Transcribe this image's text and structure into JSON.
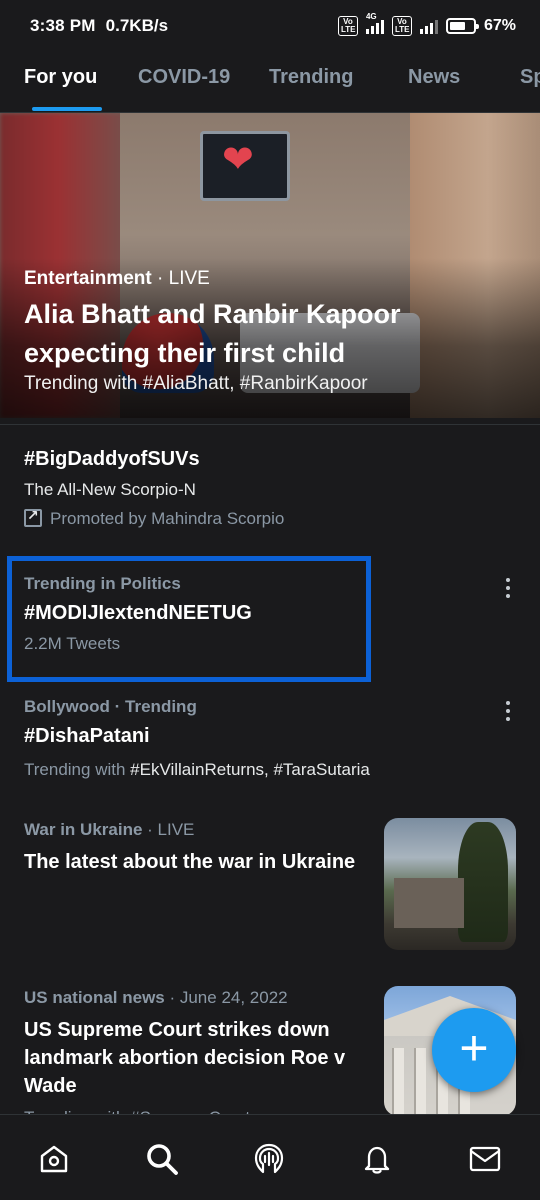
{
  "status_bar": {
    "time": "3:38 PM",
    "net_speed": "0.7KB/s",
    "volte_label": "Vo LTE",
    "network_label": "4G",
    "battery": "67%"
  },
  "tabs": [
    {
      "label": "For you",
      "active": true
    },
    {
      "label": "COVID-19",
      "active": false
    },
    {
      "label": "Trending",
      "active": false
    },
    {
      "label": "News",
      "active": false
    },
    {
      "label": "Sp",
      "active": false
    }
  ],
  "hero": {
    "category": "Entertainment",
    "status": " · LIVE",
    "headline": "Alia Bhatt and Ranbir Kapoor expecting their first child",
    "trending_with": "Trending with #AliaBhatt, #RanbirKapoor"
  },
  "promoted": {
    "title": "#BigDaddyofSUVs",
    "description": "The All-New Scorpio-N",
    "promoted_by": "Promoted by Mahindra Scorpio"
  },
  "trend_politics": {
    "category": "Trending in Politics",
    "title": "#MODIJIextendNEETUG",
    "count": "2.2M Tweets"
  },
  "trend_bollywood": {
    "category": "Bollywood · Trending",
    "title": "#DishaPatani",
    "trending_prefix": "Trending with ",
    "trending_tags": "#EkVillainReturns, #TaraSutaria"
  },
  "story_ukraine": {
    "category": "War in Ukraine",
    "status": " · LIVE",
    "title": "The latest about the war in Ukraine"
  },
  "story_court": {
    "category": "US national news",
    "date": " · June 24, 2022",
    "title": "US Supreme Court strikes down landmark abortion decision Roe v Wade",
    "trending_partial": "Trending with #SupremeCourt"
  },
  "fab": {
    "label": "+"
  },
  "bottom_nav": [
    "home",
    "search",
    "spaces",
    "notifications",
    "messages"
  ],
  "colors": {
    "accent": "#1d9bf0",
    "highlight": "#0c61d6",
    "background": "#1a1a1c"
  }
}
